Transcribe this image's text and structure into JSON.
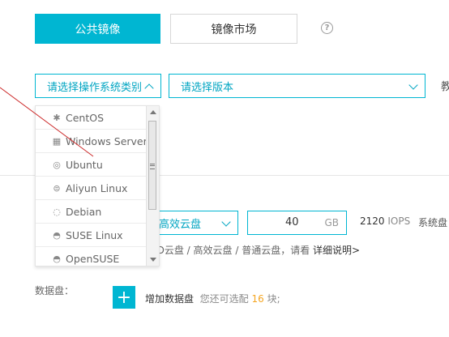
{
  "tabs": {
    "public_image": "公共镜像",
    "marketplace": "镜像市场",
    "help_glyph": "?"
  },
  "os_select": {
    "placeholder": "请选择操作系统类别"
  },
  "version_select": {
    "placeholder": "请选择版本"
  },
  "edge_text": "教",
  "os_options": [
    {
      "label": "CentOS",
      "icon": "centos-icon",
      "glyph": "✱"
    },
    {
      "label": "Windows Server",
      "icon": "windows-icon",
      "glyph": "▦"
    },
    {
      "label": "Ubuntu",
      "icon": "ubuntu-icon",
      "glyph": "◎"
    },
    {
      "label": "Aliyun Linux",
      "icon": "aliyun-icon",
      "glyph": "⊜"
    },
    {
      "label": "Debian",
      "icon": "debian-icon",
      "glyph": "◌"
    },
    {
      "label": "SUSE Linux",
      "icon": "suse-icon",
      "glyph": "◓"
    },
    {
      "label": "OpenSUSE",
      "icon": "opensuse-icon",
      "glyph": "◓"
    }
  ],
  "disk": {
    "type": "高效云盘",
    "size": "40",
    "unit": "GB",
    "iops_value": "2120",
    "iops_unit": "IOPS",
    "perf_label": "系统盘"
  },
  "desc": {
    "text": "SD云盘 / 高效云盘 / 普通云盘，请看 ",
    "link": "详细说明>"
  },
  "data_disk": {
    "label": "数据盘：",
    "add_glyph": "+",
    "add_text": "增加数据盘",
    "remain_prefix": "您还可选配",
    "remain_count": "16",
    "remain_suffix": "块;"
  },
  "colors": {
    "accent": "#00b6d2",
    "count": "#f5a623"
  }
}
